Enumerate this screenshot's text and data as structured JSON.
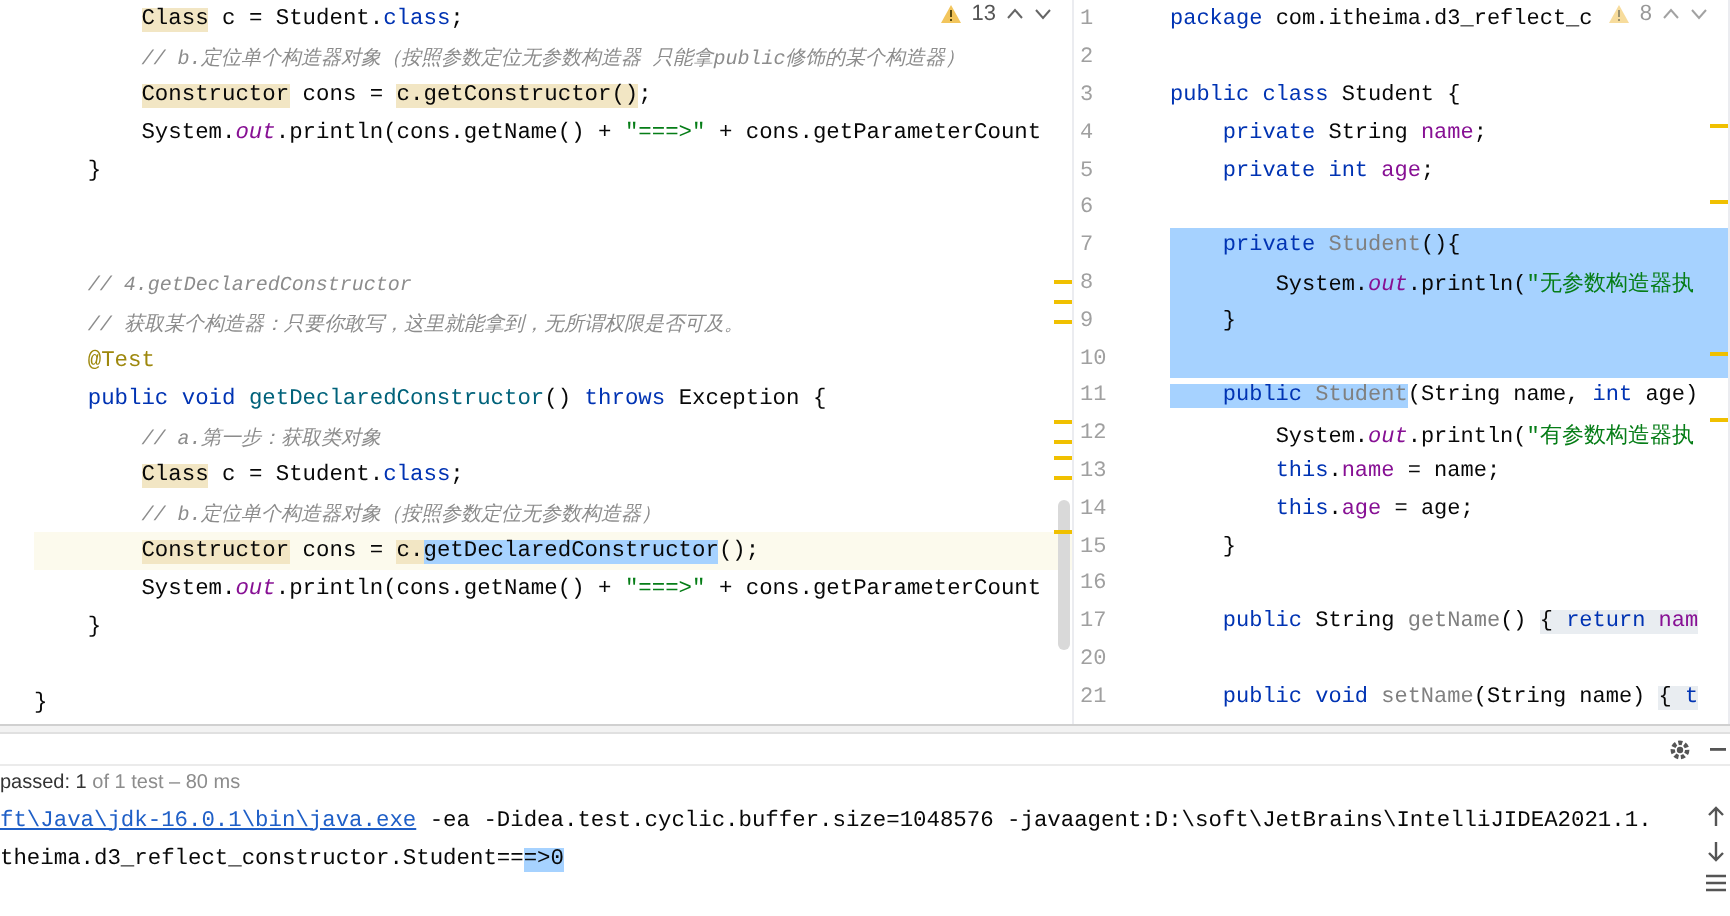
{
  "left_editor": {
    "inspection": {
      "count": "13"
    },
    "lines": [
      {
        "kind": "code",
        "segments": [
          {
            "text": "        Class",
            "kind": "plain",
            "usage": true
          },
          {
            "text": " c = Student.",
            "kind": "plain"
          },
          {
            "text": "class",
            "kind": "keyword"
          },
          {
            "text": ";",
            "kind": "plain"
          }
        ]
      },
      {
        "kind": "code",
        "segments": [
          {
            "text": "        // b.定位单个构造器对象（按照参数定位无参数构造器 只能拿public修饰的某个构造器）",
            "kind": "comment"
          }
        ]
      },
      {
        "kind": "code",
        "segments": [
          {
            "text": "        Constructor",
            "kind": "plain",
            "usage": true
          },
          {
            "text": " cons = ",
            "kind": "plain"
          },
          {
            "text": "c.getConstructor()",
            "kind": "plain",
            "usage": true
          },
          {
            "text": ";",
            "kind": "plain"
          }
        ]
      },
      {
        "kind": "code",
        "segments": [
          {
            "text": "        System.",
            "kind": "plain"
          },
          {
            "text": "out",
            "kind": "static"
          },
          {
            "text": ".println(cons.getName() + ",
            "kind": "plain"
          },
          {
            "text": "\"===>\"",
            "kind": "string"
          },
          {
            "text": " + cons.getParameterCount",
            "kind": "plain"
          }
        ]
      },
      {
        "kind": "code",
        "segments": [
          {
            "text": "    }",
            "kind": "plain"
          }
        ]
      },
      {
        "kind": "blank"
      },
      {
        "kind": "blank"
      },
      {
        "kind": "code",
        "segments": [
          {
            "text": "    // 4.getDeclaredConstructor",
            "kind": "comment"
          }
        ]
      },
      {
        "kind": "code",
        "segments": [
          {
            "text": "    // 获取某个构造器：只要你敢写，这里就能拿到，无所谓权限是否可及。",
            "kind": "comment"
          }
        ]
      },
      {
        "kind": "code",
        "segments": [
          {
            "text": "    @Test",
            "kind": "annotation"
          }
        ]
      },
      {
        "kind": "code",
        "segments": [
          {
            "text": "    public void ",
            "kind": "keyword"
          },
          {
            "text": "getDeclaredConstructor",
            "kind": "method"
          },
          {
            "text": "() ",
            "kind": "plain"
          },
          {
            "text": "throws",
            "kind": "keyword"
          },
          {
            "text": " Exception {",
            "kind": "plain"
          }
        ]
      },
      {
        "kind": "code",
        "segments": [
          {
            "text": "        // a.第一步：获取类对象",
            "kind": "comment"
          }
        ]
      },
      {
        "kind": "code",
        "segments": [
          {
            "text": "        Class",
            "kind": "plain",
            "usage": true
          },
          {
            "text": " c = Student.",
            "kind": "plain"
          },
          {
            "text": "class",
            "kind": "keyword"
          },
          {
            "text": ";",
            "kind": "plain"
          }
        ]
      },
      {
        "kind": "code",
        "segments": [
          {
            "text": "        // b.定位单个构造器对象（按照参数定位无参数构造器）",
            "kind": "comment"
          }
        ]
      },
      {
        "kind": "code",
        "current": true,
        "segments": [
          {
            "text": "        Constructor",
            "kind": "plain",
            "usage": true
          },
          {
            "text": " cons = ",
            "kind": "plain"
          },
          {
            "text": "c.",
            "kind": "plain",
            "usage": true
          },
          {
            "text": "getDeclaredConstructor",
            "kind": "plain",
            "selected": true
          },
          {
            "text": "();",
            "kind": "plain"
          }
        ]
      },
      {
        "kind": "code",
        "segments": [
          {
            "text": "        System.",
            "kind": "plain"
          },
          {
            "text": "out",
            "kind": "static"
          },
          {
            "text": ".println(cons.getName() + ",
            "kind": "plain"
          },
          {
            "text": "\"===>\"",
            "kind": "string"
          },
          {
            "text": " + cons.getParameterCount",
            "kind": "plain"
          }
        ]
      },
      {
        "kind": "code",
        "segments": [
          {
            "text": "    }",
            "kind": "plain"
          }
        ]
      },
      {
        "kind": "blank"
      },
      {
        "kind": "code",
        "segments": [
          {
            "text": "}",
            "kind": "plain"
          }
        ]
      }
    ]
  },
  "right_editor": {
    "inspection": {
      "count": "8"
    },
    "lines": [
      {
        "number": "1",
        "kind": "code",
        "segments": [
          {
            "text": "package",
            "kind": "keyword"
          },
          {
            "text": " com.itheima.d3_reflect_c",
            "kind": "plain"
          }
        ]
      },
      {
        "number": "2",
        "kind": "blank"
      },
      {
        "number": "3",
        "kind": "code",
        "segments": [
          {
            "text": "public class",
            "kind": "keyword"
          },
          {
            "text": " Student {",
            "kind": "plain"
          }
        ]
      },
      {
        "number": "4",
        "kind": "code",
        "segments": [
          {
            "text": "    private",
            "kind": "keyword"
          },
          {
            "text": " String ",
            "kind": "plain"
          },
          {
            "text": "name",
            "kind": "field"
          },
          {
            "text": ";",
            "kind": "plain"
          }
        ]
      },
      {
        "number": "5",
        "kind": "code",
        "segments": [
          {
            "text": "    private int ",
            "kind": "keyword"
          },
          {
            "text": "age",
            "kind": "field"
          },
          {
            "text": ";",
            "kind": "plain"
          }
        ]
      },
      {
        "number": "6",
        "kind": "blank"
      },
      {
        "number": "7",
        "kind": "code",
        "selected_to_end": true,
        "segments": [
          {
            "text": "    private ",
            "kind": "keyword",
            "selected": true
          },
          {
            "text": "Student",
            "kind": "unused",
            "selected": true
          },
          {
            "text": "(){",
            "kind": "plain",
            "selected": true
          }
        ]
      },
      {
        "number": "8",
        "kind": "code",
        "selected_to_end": true,
        "segments": [
          {
            "text": "        System.",
            "kind": "plain",
            "selected": true
          },
          {
            "text": "out",
            "kind": "static",
            "selected": true
          },
          {
            "text": ".println(",
            "kind": "plain",
            "selected": true
          },
          {
            "text": "\"无参数构造器执",
            "kind": "string",
            "selected": true
          }
        ]
      },
      {
        "number": "9",
        "kind": "code",
        "selected_to_end": true,
        "segments": [
          {
            "text": "    }",
            "kind": "plain",
            "selected": true
          }
        ]
      },
      {
        "number": "10",
        "kind": "blank",
        "selected_to_end": true
      },
      {
        "number": "11",
        "kind": "code",
        "segments": [
          {
            "text": "    public ",
            "kind": "keyword",
            "selected": true
          },
          {
            "text": "Student",
            "kind": "unused",
            "selected": true
          },
          {
            "text": "(String name, ",
            "kind": "plain"
          },
          {
            "text": "int",
            "kind": "keyword"
          },
          {
            "text": " age)",
            "kind": "plain"
          }
        ]
      },
      {
        "number": "12",
        "kind": "code",
        "segments": [
          {
            "text": "        System.",
            "kind": "plain"
          },
          {
            "text": "out",
            "kind": "static"
          },
          {
            "text": ".println(",
            "kind": "plain"
          },
          {
            "text": "\"有参数构造器执",
            "kind": "string"
          }
        ]
      },
      {
        "number": "13",
        "kind": "code",
        "segments": [
          {
            "text": "        this",
            "kind": "keyword"
          },
          {
            "text": ".",
            "kind": "plain"
          },
          {
            "text": "name",
            "kind": "field"
          },
          {
            "text": " = name;",
            "kind": "plain"
          }
        ]
      },
      {
        "number": "14",
        "kind": "code",
        "segments": [
          {
            "text": "        this",
            "kind": "keyword"
          },
          {
            "text": ".",
            "kind": "plain"
          },
          {
            "text": "age",
            "kind": "field"
          },
          {
            "text": " = age;",
            "kind": "plain"
          }
        ]
      },
      {
        "number": "15",
        "kind": "code",
        "segments": [
          {
            "text": "    }",
            "kind": "plain"
          }
        ]
      },
      {
        "number": "16",
        "kind": "blank"
      },
      {
        "number": "17",
        "kind": "code",
        "segments": [
          {
            "text": "    public",
            "kind": "keyword"
          },
          {
            "text": " String ",
            "kind": "plain"
          },
          {
            "text": "getName",
            "kind": "unused"
          },
          {
            "text": "() ",
            "kind": "plain"
          },
          {
            "text": "{ ",
            "kind": "plain",
            "folded": true
          },
          {
            "text": "return ",
            "kind": "keyword",
            "folded": true
          },
          {
            "text": "nam",
            "kind": "field",
            "folded": true
          }
        ]
      },
      {
        "number": "20",
        "kind": "blank"
      },
      {
        "number": "21",
        "kind": "code",
        "segments": [
          {
            "text": "    public void ",
            "kind": "keyword"
          },
          {
            "text": "setName",
            "kind": "unused"
          },
          {
            "text": "(String name) ",
            "kind": "plain"
          },
          {
            "text": "{ ",
            "kind": "plain",
            "folded": true
          },
          {
            "text": "t",
            "kind": "keyword",
            "folded": true
          }
        ]
      }
    ]
  },
  "run_panel": {
    "status": {
      "passed": "passed: 1",
      "detail": "of 1 test – 80 ms"
    },
    "output": [
      {
        "segments": [
          {
            "text": "ft\\Java\\jdk-16.0.1\\bin\\java.exe",
            "kind": "link"
          },
          {
            "text": " -ea -Didea.test.cyclic.buffer.size=1048576 -javaagent:D:\\soft\\JetBrains\\IntelliJIDEA2021.1.",
            "kind": "plain"
          }
        ]
      },
      {
        "segments": [
          {
            "text": "theima.d3_reflect_constructor.Student==",
            "kind": "plain"
          },
          {
            "text": "=>0",
            "kind": "plain",
            "selected": true
          }
        ]
      }
    ]
  }
}
